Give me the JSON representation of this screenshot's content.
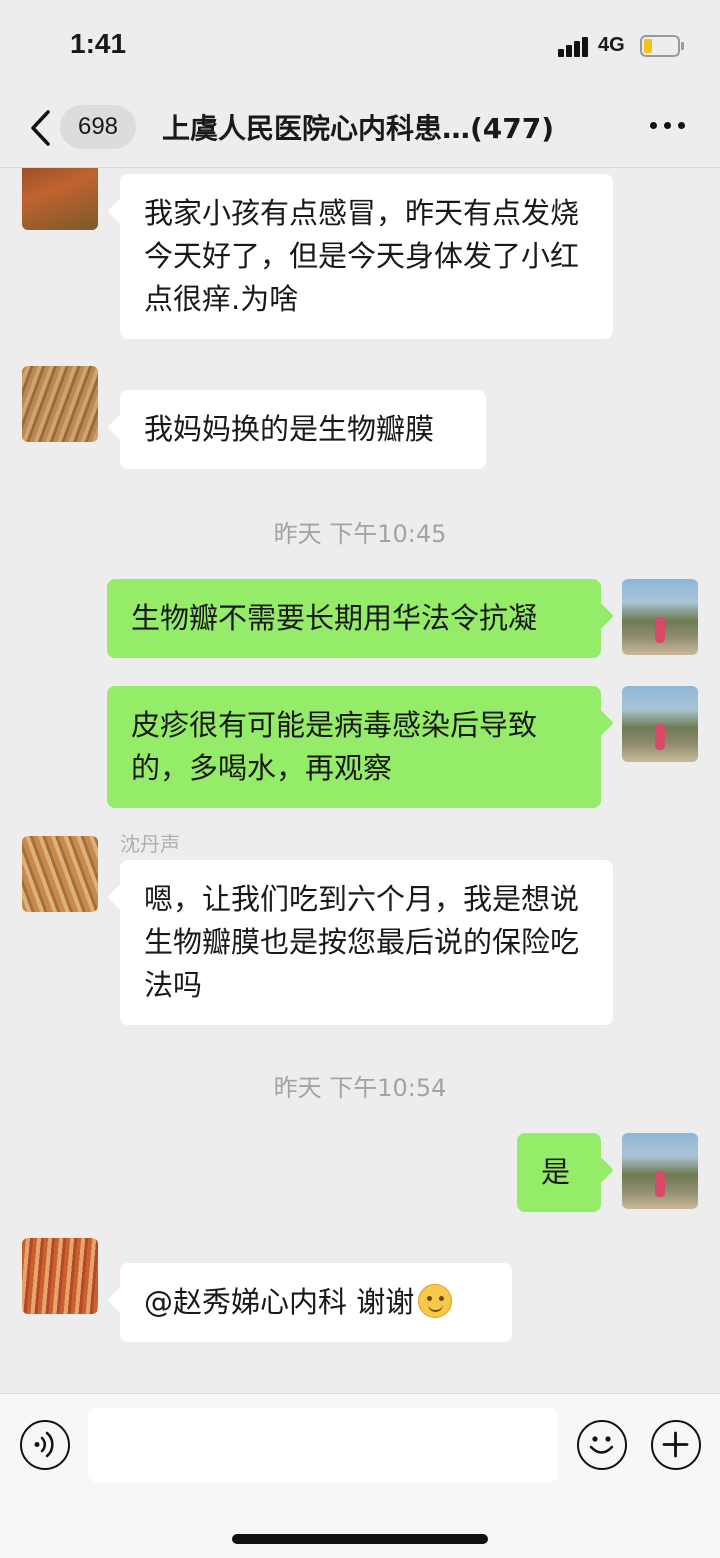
{
  "status_bar": {
    "time": "1:41",
    "network": "4G",
    "battery_color": "#f4c21a"
  },
  "nav": {
    "unread_count": "698",
    "title": "上虞人民医院心内科患…(477)",
    "icons": {
      "back": "chevron-left-icon",
      "more": "more-dots-icon"
    }
  },
  "messages": [
    {
      "side": "in",
      "text": "我家小孩有点感冒，昨天有点发烧今天好了，但是今天身体发了小红点很痒.为啥"
    },
    {
      "side": "in",
      "text": "我妈妈换的是生物瓣膜"
    },
    {
      "type": "time",
      "text": "昨天 下午10:45"
    },
    {
      "side": "out",
      "text": "生物瓣不需要长期用华法令抗凝"
    },
    {
      "side": "out",
      "text": "皮疹很有可能是病毒感染后导致的，多喝水，再观察"
    },
    {
      "side": "in",
      "sender": "沈丹声",
      "text": "嗯，让我们吃到六个月，我是想说生物瓣膜也是按您最后说的保险吃法吗"
    },
    {
      "type": "time",
      "text": "昨天 下午10:54"
    },
    {
      "side": "out",
      "text": "是"
    },
    {
      "side": "in",
      "text": "@赵秀娣心内科 谢谢",
      "emoji": "smile-emoji"
    }
  ],
  "colors": {
    "bubble_out": "#95ec69",
    "bubble_in": "#ffffff",
    "background": "#ededed"
  },
  "input_bar": {
    "voice_icon": "voice-icon",
    "emoji_icon": "smiley-icon",
    "plus_icon": "plus-icon",
    "placeholder": ""
  }
}
